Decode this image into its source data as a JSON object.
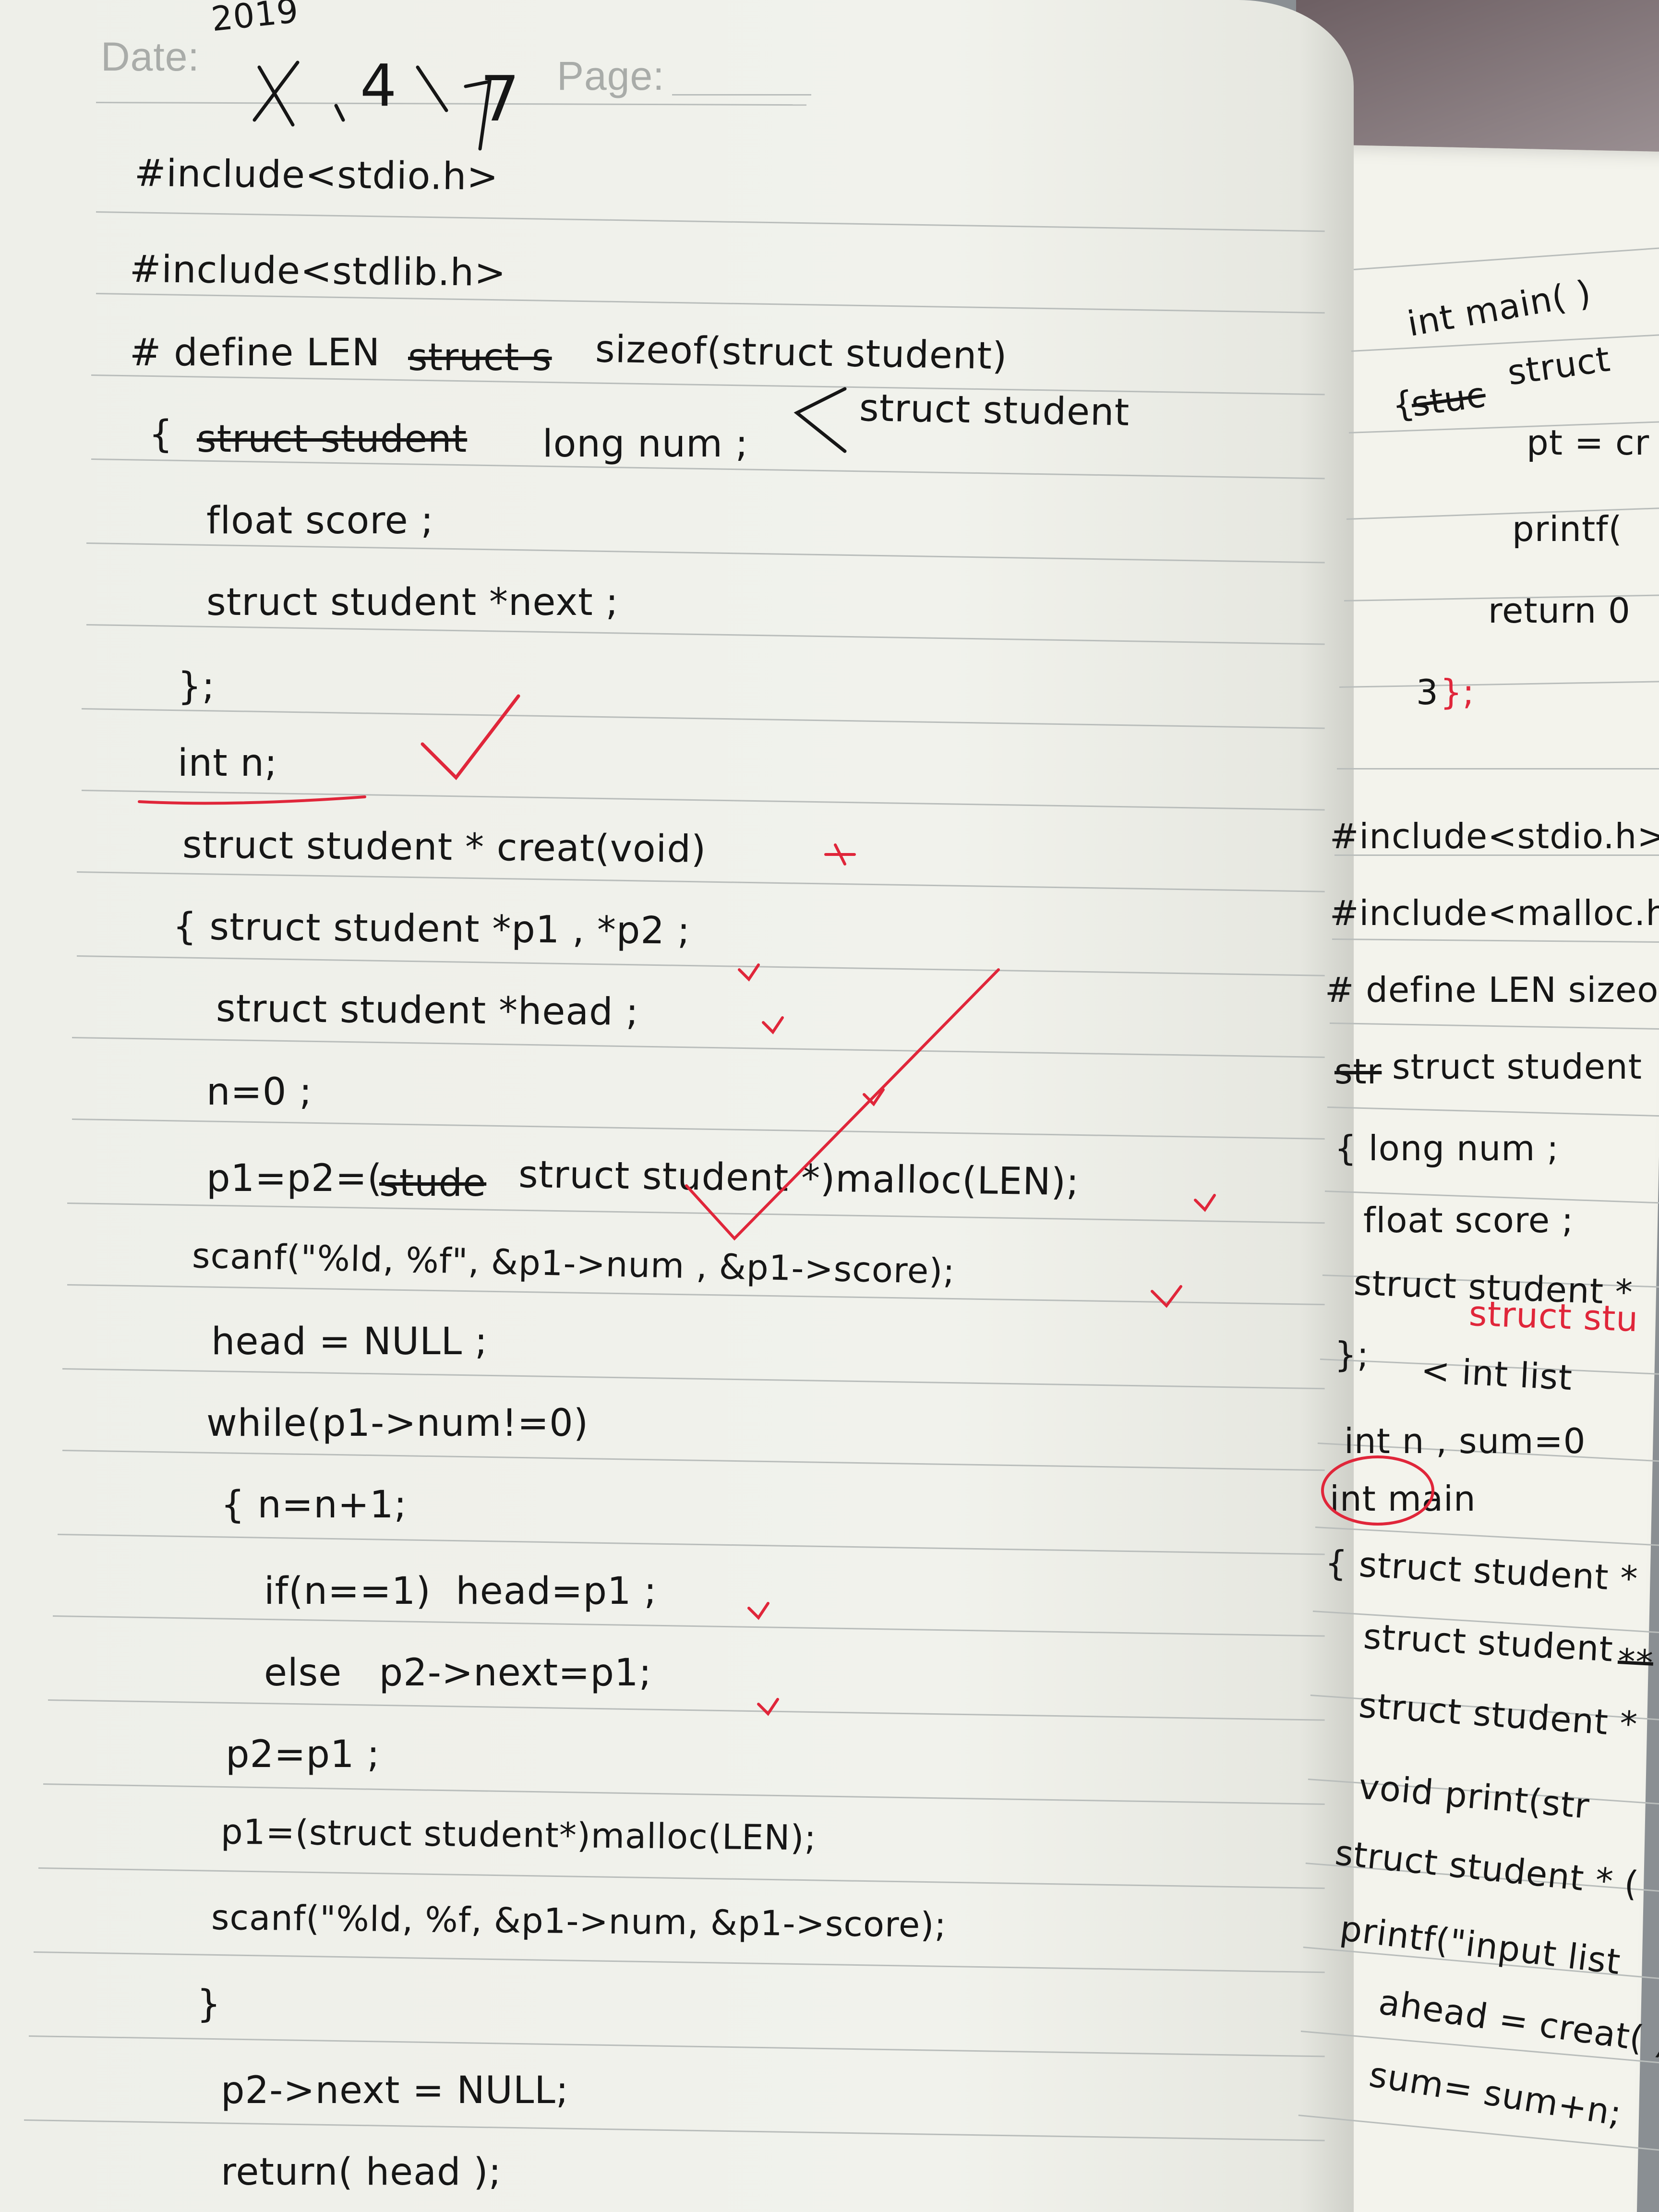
{
  "header": {
    "date_label": "Date:",
    "page_label": "Page:",
    "year": "2019",
    "month": "4",
    "day": "7"
  },
  "left_page": {
    "lines": [
      "#include<stdio.h>",
      "#include<stdlib.h>",
      "# define LEN",
      "struct s",
      "sizeof(struct student)",
      "{",
      "struct student",
      "long num ;",
      "struct student",
      "float score ;",
      "struct student *next ;",
      "};",
      "int n;",
      "struct student * creat(void)",
      "{ struct student *p1 , *p2 ;",
      "struct student *head ;",
      "n=0 ;",
      "p1=p2=(",
      "stude",
      "struct student *)malloc(LEN);",
      "scanf(\"%ld, %f\", &p1->num , &p1->score);",
      "head = NULL ;",
      "while(p1->num!=0)",
      "{ n=n+1;",
      "if(n==1)  head=p1 ;",
      "else   p2->next=p1;",
      "p2=p1 ;",
      "p1=(struct student*)malloc(LEN);",
      "scanf(\"%ld, %f, &p1->num, &p1->score);",
      "}",
      "p2->next = NULL;",
      "return( head );"
    ]
  },
  "right_page": {
    "lines": [
      "int main( )",
      "{",
      "stuc",
      "struct",
      "pt = cr",
      "printf(",
      "return 0",
      "3",
      "};",
      "#include<stdio.h>",
      "#include<malloc.h>",
      "# define LEN sizeof",
      "str",
      "struct student",
      "{ long num ;",
      "float score ;",
      "struct student *",
      "struct stu",
      "};",
      "< int list",
      "int n , sum=0",
      "int main",
      "{ struct student *",
      "struct student",
      "**",
      "struct student *",
      "void print(str",
      "struct student * (",
      "printf(\"input list",
      "ahead = creat( )",
      "sum= sum+n;"
    ]
  },
  "colors": {
    "ink": "#161616",
    "correction": "#e0263a",
    "paper": "#f1f2ec",
    "rule": "#b9bdbb"
  }
}
